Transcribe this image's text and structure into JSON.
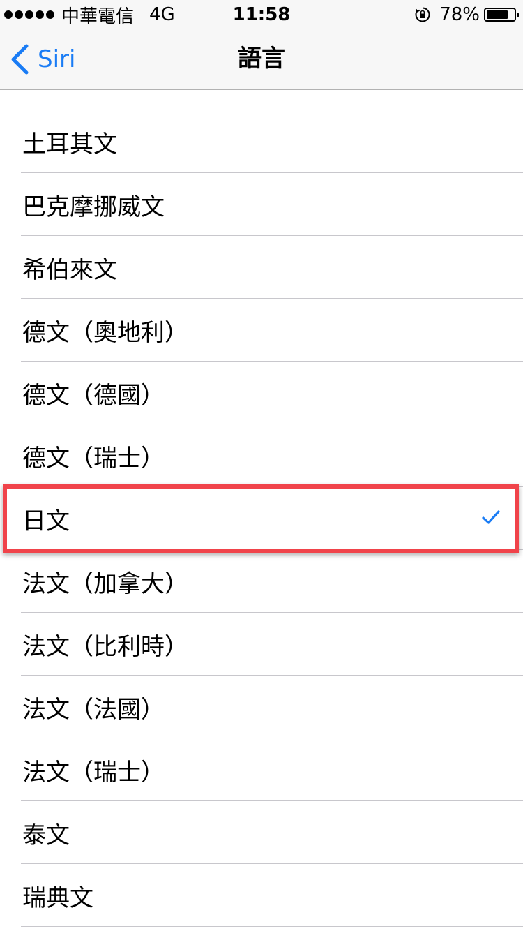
{
  "status_bar": {
    "carrier": "中華電信",
    "network": "4G",
    "time": "11:58",
    "battery": "78%",
    "battery_level": 0.78
  },
  "nav": {
    "back_label": "Siri",
    "title": "語言"
  },
  "languages": [
    {
      "label": "土耳其文",
      "selected": false
    },
    {
      "label": "巴克摩挪威文",
      "selected": false
    },
    {
      "label": "希伯來文",
      "selected": false
    },
    {
      "label": "德文（奧地利）",
      "selected": false
    },
    {
      "label": "德文（德國）",
      "selected": false
    },
    {
      "label": "德文（瑞士）",
      "selected": false
    },
    {
      "label": "日文",
      "selected": true
    },
    {
      "label": "法文（加拿大）",
      "selected": false
    },
    {
      "label": "法文（比利時）",
      "selected": false
    },
    {
      "label": "法文（法國）",
      "selected": false
    },
    {
      "label": "法文（瑞士）",
      "selected": false
    },
    {
      "label": "泰文",
      "selected": false
    },
    {
      "label": "瑞典文",
      "selected": false
    }
  ],
  "colors": {
    "accent": "#1a7cf5",
    "highlight": "#f0434a"
  }
}
